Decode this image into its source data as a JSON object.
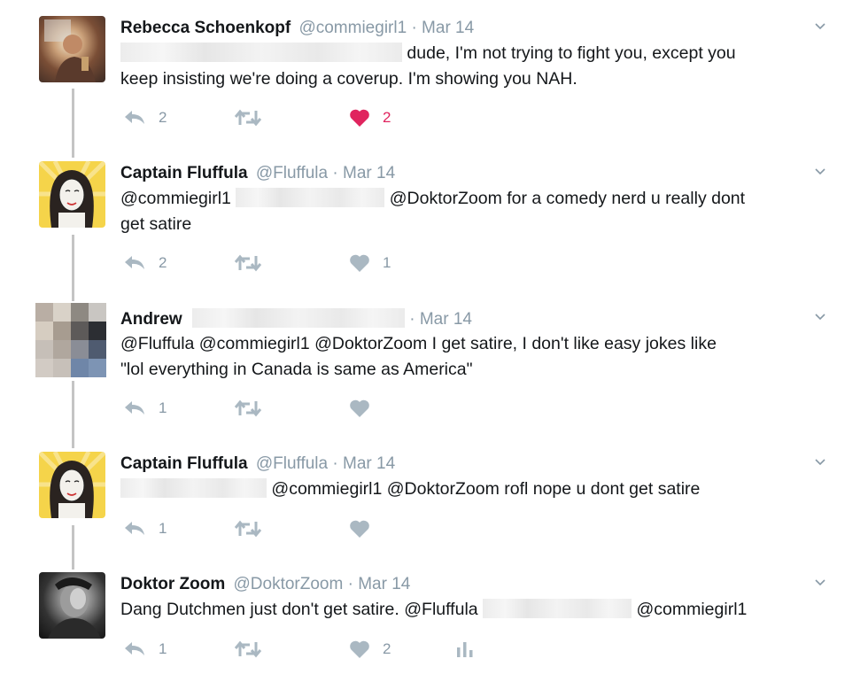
{
  "tweets": [
    {
      "name": "Rebecca Schoenkopf",
      "handle": "@commiegirl1",
      "time": "· Mar 14",
      "line1_text": "dude, I'm not trying to fight you, except you",
      "line2_text": "keep insisting we're doing a coverup. I'm showing you NAH.",
      "replies": "2",
      "retweets": "",
      "likes": "2",
      "liked": true
    },
    {
      "name": "Captain Fluffula",
      "handle": "@Fluffula",
      "time": "· Mar 14",
      "line1_mention1": "@commiegirl1",
      "line1_mention2": "@DoktorZoom",
      "line1_text": "for a comedy nerd u really dont",
      "line2_text": "get satire",
      "replies": "2",
      "retweets": "",
      "likes": "1",
      "liked": false
    },
    {
      "name": "Andrew",
      "handle": "",
      "time": "· Mar 14",
      "line1_text": "@Fluffula @commiegirl1 @DoktorZoom I get satire, I don't like easy jokes like",
      "line2_text": "\"lol everything in Canada is same as America\"",
      "replies": "1",
      "retweets": "",
      "likes": "",
      "liked": false
    },
    {
      "name": "Captain Fluffula",
      "handle": "@Fluffula",
      "time": "· Mar 14",
      "line1_text": "@commiegirl1 @DoktorZoom rofl nope u dont get satire",
      "replies": "1",
      "retweets": "",
      "likes": "",
      "liked": false
    },
    {
      "name": "Doktor Zoom",
      "handle": "@DoktorZoom",
      "time": "· Mar 14",
      "line1_text": "Dang Dutchmen just don't get satire.",
      "line1_mention1": "@Fluffula",
      "line1_mention2": "@commiegirl1",
      "replies": "1",
      "retweets": "",
      "likes": "2",
      "liked": false
    }
  ],
  "icons": {
    "reply": "reply-icon",
    "retweet": "retweet-icon",
    "like": "heart-icon",
    "analytics": "analytics-icon",
    "caret": "chevron-down-icon"
  },
  "colors": {
    "icon_gray": "#aab8c2",
    "liked_red": "#e0245e",
    "meta_gray": "#8899a6",
    "thread_line": "#c4c4c4"
  }
}
